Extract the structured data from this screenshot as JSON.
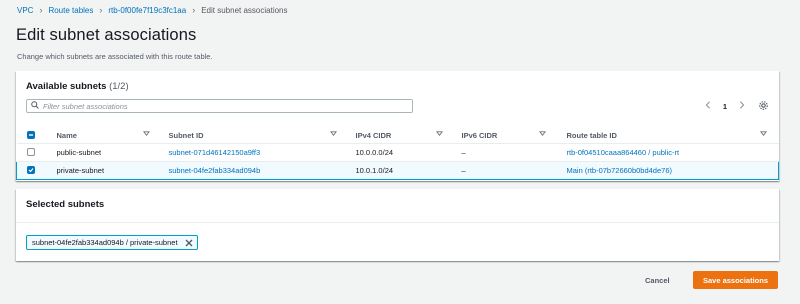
{
  "breadcrumb": {
    "items": [
      "VPC",
      "Route tables",
      "rtb-0f00fe7f19c3fc1aa"
    ],
    "current": "Edit subnet associations"
  },
  "page": {
    "title": "Edit subnet associations",
    "description": "Change which subnets are associated with this route table."
  },
  "available": {
    "title": "Available subnets",
    "count": "(1/2)",
    "filter_placeholder": "Filter subnet associations",
    "page_number": "1",
    "columns": [
      "Name",
      "Subnet ID",
      "IPv4 CIDR",
      "IPv6 CIDR",
      "Route table ID"
    ],
    "rows": [
      {
        "name": "public-subnet",
        "subnet_id": "subnet-071d46142150a9ff3",
        "ipv4": "10.0.0.0/24",
        "ipv6": "–",
        "route_table": "rtb-0f04510caaa864460 / public-rt",
        "selected": false
      },
      {
        "name": "private-subnet",
        "subnet_id": "subnet-04fe2fab334ad094b",
        "ipv4": "10.0.1.0/24",
        "ipv6": "–",
        "route_table": "Main (rtb-07b72660b0bd4de76)",
        "selected": true
      }
    ]
  },
  "selected_subnets": {
    "title": "Selected subnets",
    "tokens": [
      "subnet-04fe2fab334ad094b / private-subnet"
    ]
  },
  "actions": {
    "cancel": "Cancel",
    "save": "Save associations"
  },
  "colors": {
    "link": "#0073bb",
    "primary_button": "#ec7211",
    "selection_border": "#00a1c9",
    "selection_bg": "#f1faff"
  }
}
